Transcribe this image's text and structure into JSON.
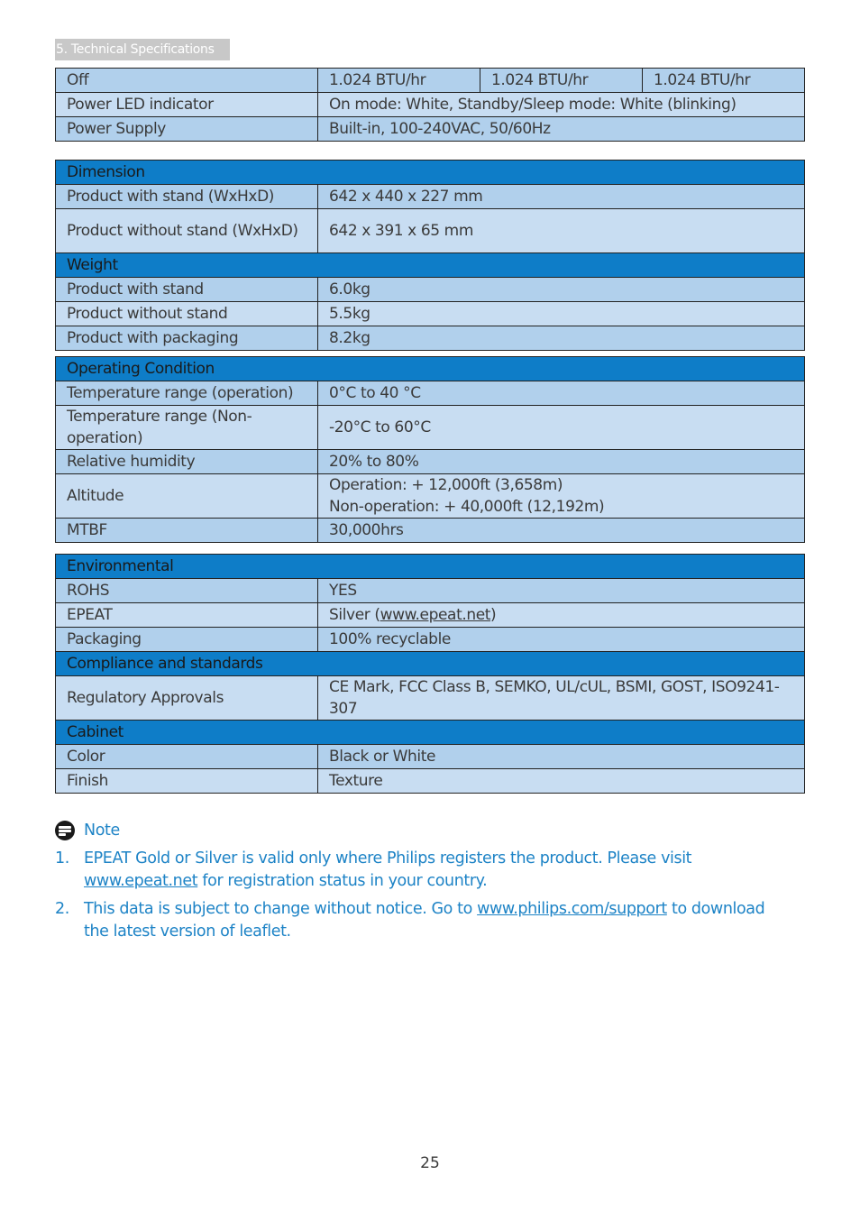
{
  "section_tag": "5. Technical Specifications",
  "power_table": {
    "off": {
      "label": "Off",
      "values": [
        "1.024 BTU/hr",
        "1.024 BTU/hr",
        "1.024 BTU/hr"
      ]
    },
    "power_led": {
      "label": "Power LED indicator",
      "value": "On mode: White, Standby/Sleep mode: White (blinking)"
    },
    "power_supply": {
      "label": "Power Supply",
      "value": "Built-in, 100-240VAC, 50/60Hz"
    }
  },
  "dimension": {
    "title": "Dimension",
    "rows": [
      {
        "label": "Product with stand (WxHxD)",
        "value": "642 x 440 x 227 mm"
      },
      {
        "label": "Product without stand (WxHxD)",
        "value": "642 x 391 x 65 mm"
      }
    ]
  },
  "weight": {
    "title": "Weight",
    "rows": [
      {
        "label": "Product with stand",
        "value": "6.0kg"
      },
      {
        "label": "Product without stand",
        "value": "5.5kg"
      },
      {
        "label": "Product with packaging",
        "value": "8.2kg"
      }
    ]
  },
  "operating": {
    "title": "Operating Condition",
    "rows": [
      {
        "label": "Temperature range (operation)",
        "value": "0°C to 40 °C"
      },
      {
        "label": "Temperature range (Non-operation)",
        "value": "-20°C to 60°C"
      },
      {
        "label": "Relative humidity",
        "value": "20% to 80%"
      },
      {
        "label": "Altitude",
        "value_line1": "Operation: + 12,000ft (3,658m)",
        "value_line2": "Non-operation: + 40,000ft (12,192m)"
      },
      {
        "label": "MTBF",
        "value": "30,000hrs"
      }
    ]
  },
  "environmental": {
    "title": "Environmental",
    "rows": [
      {
        "label": "ROHS",
        "value": "YES"
      },
      {
        "label": "EPEAT",
        "value_prefix": "Silver (",
        "link": "www.epeat.net",
        "value_suffix": ")"
      },
      {
        "label": "Packaging",
        "value": "100% recyclable"
      }
    ]
  },
  "compliance": {
    "title": "Compliance and standards",
    "rows": [
      {
        "label": "Regulatory Approvals",
        "value": "CE Mark, FCC Class B, SEMKO, UL/cUL,  BSMI, GOST, ISO9241-307"
      }
    ]
  },
  "cabinet": {
    "title": "Cabinet",
    "rows": [
      {
        "label": "Color",
        "value": "Black or White"
      },
      {
        "label": "Finish",
        "value": "Texture"
      }
    ]
  },
  "note": {
    "title": "Note",
    "items": [
      {
        "num": "1.",
        "text_before": "EPEAT Gold or Silver is valid only where Philips registers the product. Please visit ",
        "link": "www.epeat.net",
        "text_after": " for registration status in your country."
      },
      {
        "num": "2.",
        "text_before": "This data is subject to change without notice. Go to ",
        "link": "www.philips.com/support",
        "text_after": " to download the latest version of leaflet."
      }
    ]
  },
  "page_number": "25"
}
